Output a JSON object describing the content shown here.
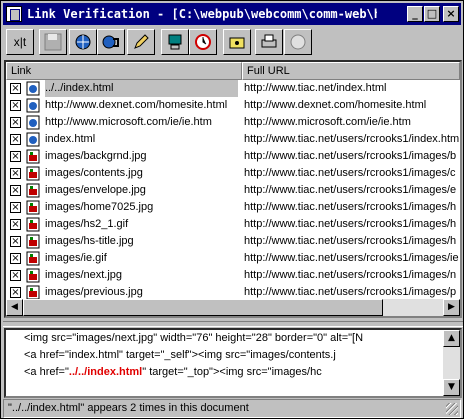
{
  "window": {
    "title": "Link Verification - [C:\\webpub\\webcomm\\comm-web\\h...",
    "controls": {
      "minimize": "_",
      "maximize": "□",
      "close": "×"
    }
  },
  "toolbar": {
    "buttons": [
      {
        "name": "exit-button",
        "label": "x|t",
        "icon": "exit-icon"
      },
      {
        "name": "save-button",
        "label": "",
        "icon": "floppy-disk-icon"
      },
      {
        "name": "verify-link-button",
        "label": "",
        "icon": "globe-link-icon"
      },
      {
        "name": "verify-all-button",
        "label": "",
        "icon": "globe-chain-icon"
      },
      {
        "name": "edit-button",
        "label": "",
        "icon": "pen-icon"
      },
      {
        "name": "copy-button",
        "label": "",
        "icon": "computer-icon"
      },
      {
        "name": "stop-button",
        "label": "",
        "icon": "clock-icon"
      },
      {
        "name": "browser-button",
        "label": "",
        "icon": "folder-eye-icon"
      },
      {
        "name": "print-button",
        "label": "",
        "icon": "printer-icon"
      },
      {
        "name": "help-button",
        "label": "",
        "icon": "circle-icon"
      }
    ]
  },
  "grid": {
    "columns": [
      "Link",
      "Full URL"
    ],
    "rows": [
      {
        "checked": true,
        "type": "html",
        "link": "../../index.html",
        "full": "http://www.tiac.net/index.html",
        "selected": true
      },
      {
        "checked": true,
        "type": "html",
        "link": "http://www.dexnet.com/homesite.html",
        "full": "http://www.dexnet.com/homesite.html"
      },
      {
        "checked": true,
        "type": "html",
        "link": "http://www.microsoft.com/ie/ie.htm",
        "full": "http://www.microsoft.com/ie/ie.htm"
      },
      {
        "checked": true,
        "type": "html",
        "link": "index.html",
        "full": "http://www.tiac.net/users/rcrooks1/index.htm"
      },
      {
        "checked": true,
        "type": "image",
        "link": "images/backgrnd.jpg",
        "full": "http://www.tiac.net/users/rcrooks1/images/b"
      },
      {
        "checked": true,
        "type": "image",
        "link": "images/contents.jpg",
        "full": "http://www.tiac.net/users/rcrooks1/images/c"
      },
      {
        "checked": true,
        "type": "image",
        "link": "images/envelope.jpg",
        "full": "http://www.tiac.net/users/rcrooks1/images/e"
      },
      {
        "checked": true,
        "type": "image",
        "link": "images/home7025.jpg",
        "full": "http://www.tiac.net/users/rcrooks1/images/h"
      },
      {
        "checked": true,
        "type": "image",
        "link": "images/hs2_1.gif",
        "full": "http://www.tiac.net/users/rcrooks1/images/h"
      },
      {
        "checked": true,
        "type": "image",
        "link": "images/hs-title.jpg",
        "full": "http://www.tiac.net/users/rcrooks1/images/h"
      },
      {
        "checked": true,
        "type": "image",
        "link": "images/ie.gif",
        "full": "http://www.tiac.net/users/rcrooks1/images/ie"
      },
      {
        "checked": true,
        "type": "image",
        "link": "images/next.jpg",
        "full": "http://www.tiac.net/users/rcrooks1/images/n"
      },
      {
        "checked": true,
        "type": "image",
        "link": "images/previous.jpg",
        "full": "http://www.tiac.net/users/rcrooks1/images/p"
      }
    ]
  },
  "code": {
    "lines": [
      {
        "prefix": "<img src=\"images/next.jpg\" width=\"76\" height=\"28\" border=\"0\" alt=\"[N",
        "highlight": "",
        "suffix": ""
      },
      {
        "prefix": "<a href=\"index.html\" target=\"_self\"><img src=\"images/contents.j",
        "highlight": "",
        "suffix": ""
      },
      {
        "prefix": "<a href=\"",
        "highlight": "../../index.html",
        "suffix": "\" target=\"_top\"><img src=\"images/hc"
      }
    ]
  },
  "status": {
    "text": "\"../../index.html\" appears 2 times in this document"
  }
}
